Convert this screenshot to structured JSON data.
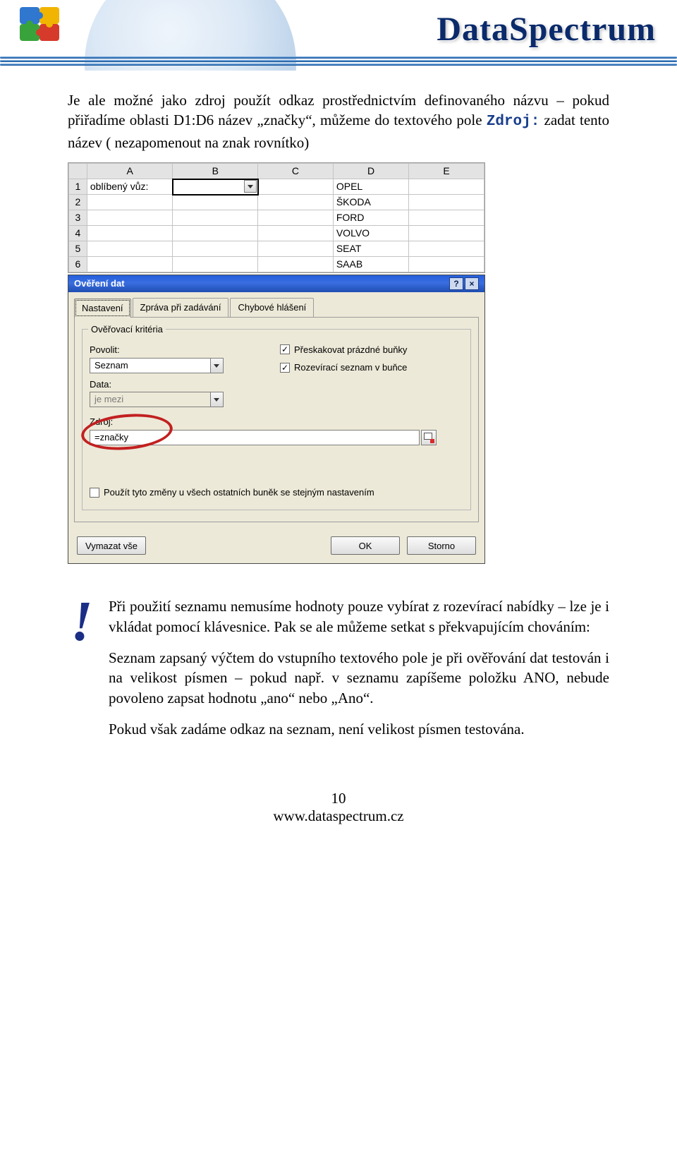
{
  "banner": {
    "brand": "DataSpectrum"
  },
  "intro": {
    "pre": "Je ale možné jako zdroj použít odkaz prostřednictvím definovaného názvu – pokud přiřadíme oblasti D1:D6 název „značky“, můžeme do textového pole ",
    "src_label": "Zdroj:",
    "post": " zadat tento název ( nezapomenout na znak rovnítko)"
  },
  "sheet": {
    "cols": [
      "A",
      "B",
      "C",
      "D",
      "E"
    ],
    "rows": [
      {
        "n": "1",
        "A": "oblíbený vůz:",
        "D": "OPEL"
      },
      {
        "n": "2",
        "D": "ŠKODA"
      },
      {
        "n": "3",
        "D": "FORD"
      },
      {
        "n": "4",
        "D": "VOLVO"
      },
      {
        "n": "5",
        "D": "SEAT"
      },
      {
        "n": "6",
        "D": "SAAB"
      }
    ]
  },
  "dlg": {
    "title": "Ověření dat",
    "help_btn": "?",
    "close_btn": "×",
    "tabs": {
      "t1": "Nastavení",
      "t2": "Zpráva při zadávání",
      "t3": "Chybové hlášení"
    },
    "group_legend": "Ověřovací kritéria",
    "allow_label": "Povolit:",
    "allow_value": "Seznam",
    "data_label": "Data:",
    "data_value": "je mezi",
    "chk_skip": "Přeskakovat prázdné buňky",
    "chk_dd": "Rozevírací seznam v buňce",
    "src_label": "Zdroj:",
    "src_value": "=značky",
    "apply_all": "Použít tyto změny u všech ostatních buněk se stejným nastavením",
    "btn_clear": "Vymazat vše",
    "btn_ok": "OK",
    "btn_cancel": "Storno"
  },
  "note": {
    "p1": "Při použití seznamu nemusíme hodnoty pouze vybírat z rozevírací nabídky – lze je i vkládat pomocí klávesnice. Pak se ale můžeme setkat s překvapujícím chováním:",
    "p2": "Seznam zapsaný výčtem do vstupního textového pole je při ověřování dat testován i na velikost písmen – pokud např. v seznamu zapíšeme položku ANO, nebude povoleno zapsat hodnotu „ano“ nebo „Ano“.",
    "p3": "Pokud však zadáme odkaz na seznam, není velikost písmen testována."
  },
  "footer": {
    "page": "10",
    "url": "www.dataspectrum.cz"
  }
}
